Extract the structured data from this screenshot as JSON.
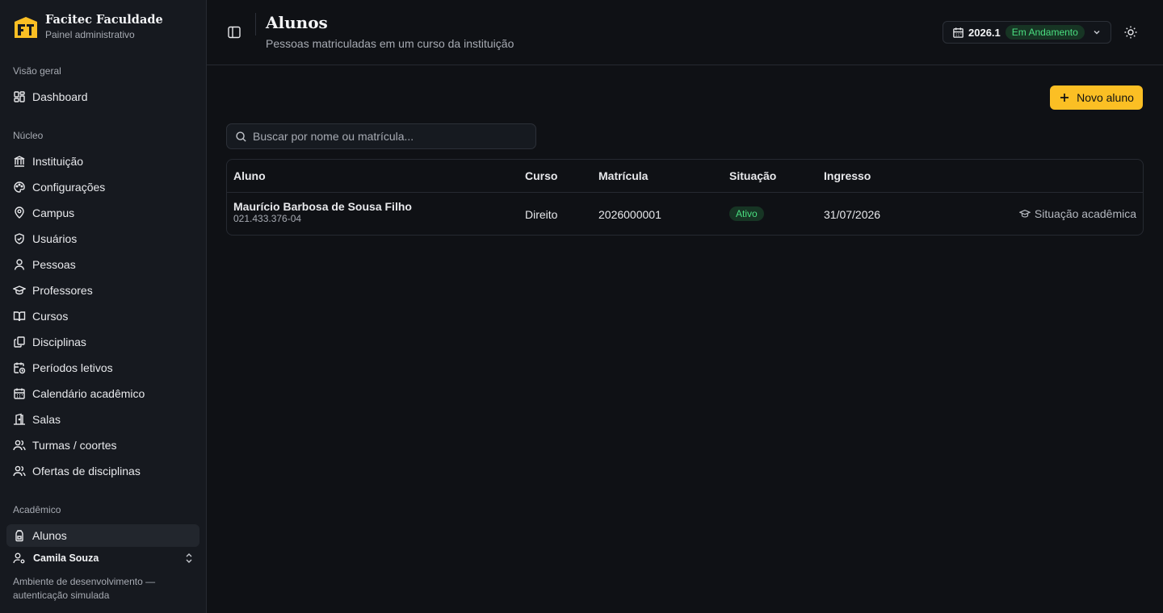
{
  "brand": {
    "name": "Facitec Faculdade",
    "subtitle": "Painel administrativo",
    "accent": "#fbbf24"
  },
  "sidebar": {
    "sections": [
      {
        "title": "Visão geral",
        "items": [
          {
            "label": "Dashboard",
            "icon": "dashboard-icon"
          }
        ]
      },
      {
        "title": "Núcleo",
        "items": [
          {
            "label": "Instituição",
            "icon": "landmark-icon"
          },
          {
            "label": "Configurações",
            "icon": "palette-icon"
          },
          {
            "label": "Campus",
            "icon": "map-pin-icon"
          },
          {
            "label": "Usuários",
            "icon": "shield-icon"
          },
          {
            "label": "Pessoas",
            "icon": "user-icon"
          },
          {
            "label": "Professores",
            "icon": "graduation-cap-icon"
          },
          {
            "label": "Cursos",
            "icon": "book-open-icon"
          },
          {
            "label": "Disciplinas",
            "icon": "files-icon"
          },
          {
            "label": "Períodos letivos",
            "icon": "calendar-clock-icon"
          },
          {
            "label": "Calendário acadêmico",
            "icon": "calendar-icon"
          },
          {
            "label": "Salas",
            "icon": "door-icon"
          },
          {
            "label": "Turmas / coortes",
            "icon": "users-icon"
          },
          {
            "label": "Ofertas de disciplinas",
            "icon": "users-icon"
          }
        ]
      },
      {
        "title": "Acadêmico",
        "items": [
          {
            "label": "Alunos",
            "icon": "backpack-icon",
            "active": true
          }
        ]
      }
    ],
    "user": {
      "name": "Camila Souza"
    },
    "env_note": "Ambiente de desenvolvimento — autenticação simulada"
  },
  "header": {
    "title": "Alunos",
    "subtitle": "Pessoas matriculadas em um curso da instituição",
    "period": {
      "year": "2026.1",
      "status": "Em Andamento"
    }
  },
  "main": {
    "new_button": "Novo aluno",
    "search_placeholder": "Buscar por nome ou matrícula...",
    "table": {
      "columns": [
        "Aluno",
        "Curso",
        "Matrícula",
        "Situação",
        "Ingresso"
      ],
      "rows": [
        {
          "name": "Maurício Barbosa de Sousa Filho",
          "cpf": "021.433.376-04",
          "course": "Direito",
          "registration": "2026000001",
          "status": "Ativo",
          "entry": "31/07/2026",
          "action": "Situação acadêmica"
        }
      ]
    }
  }
}
